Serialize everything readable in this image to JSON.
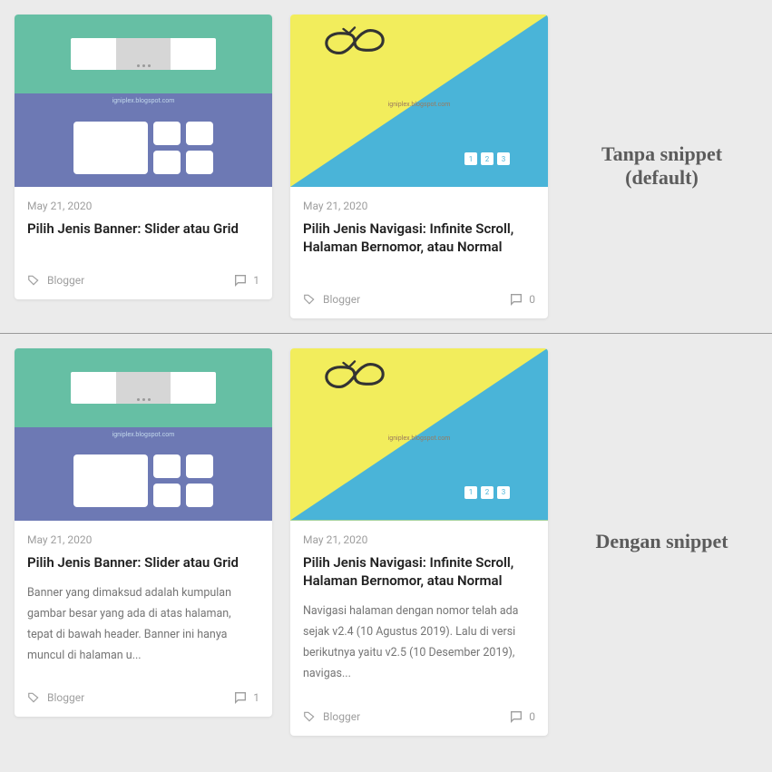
{
  "watermark": "igniplex.blogspot.com",
  "pager": [
    "1",
    "2",
    "3"
  ],
  "sections": {
    "top": {
      "label": "Tanpa snippet (default)",
      "cards": [
        {
          "date": "May 21, 2020",
          "title": "Pilih Jenis Banner: Slider atau Grid",
          "category": "Blogger",
          "comments": "1"
        },
        {
          "date": "May 21, 2020",
          "title": "Pilih Jenis Navigasi: Infinite Scroll, Halaman Bernomor, atau Normal",
          "category": "Blogger",
          "comments": "0"
        }
      ]
    },
    "bottom": {
      "label": "Dengan snippet",
      "cards": [
        {
          "date": "May 21, 2020",
          "title": "Pilih Jenis Banner: Slider atau Grid",
          "snippet": "Banner yang dimaksud adalah kumpulan gambar besar yang ada di atas halaman, tepat di bawah header. Banner ini hanya muncul di halaman u...",
          "category": "Blogger",
          "comments": "1"
        },
        {
          "date": "May 21, 2020",
          "title": "Pilih Jenis Navigasi: Infinite Scroll, Halaman Bernomor, atau Normal",
          "snippet": "Navigasi halaman dengan nomor telah ada sejak v2.4 (10 Agustus 2019). Lalu di versi berikutnya yaitu v2.5 (10 Desember 2019), navigas...",
          "category": "Blogger",
          "comments": "0"
        }
      ]
    }
  }
}
